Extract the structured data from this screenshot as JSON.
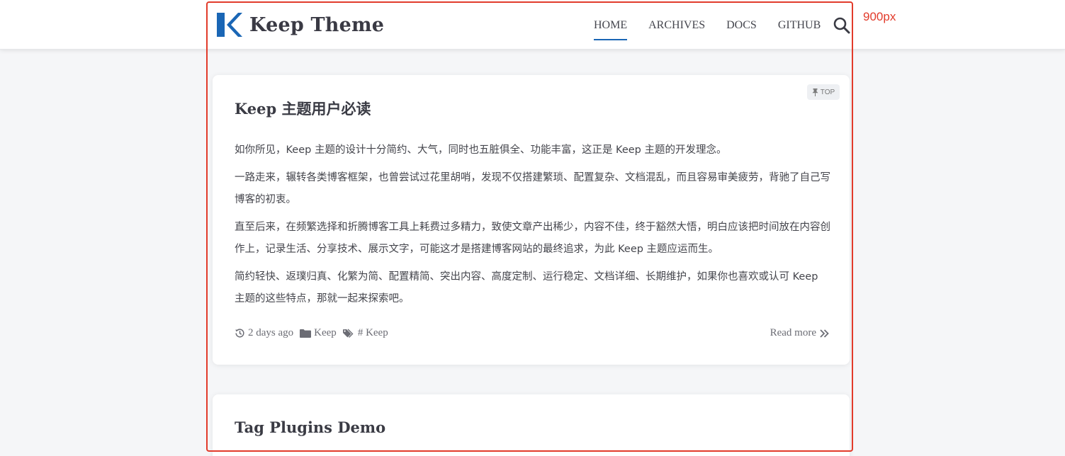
{
  "header": {
    "site_title": "Keep Theme",
    "nav": [
      {
        "label": "HOME",
        "active": true
      },
      {
        "label": "ARCHIVES",
        "active": false
      },
      {
        "label": "DOCS",
        "active": false
      },
      {
        "label": "GITHUB",
        "active": false
      }
    ],
    "search_icon": "search-icon",
    "accent_color": "#1a66b5"
  },
  "annotation": {
    "width_label": "900px",
    "color": "#e23b2b"
  },
  "posts": [
    {
      "badge": "TOP",
      "title": "Keep 主题用户必读",
      "paragraphs": [
        "如你所见，Keep 主题的设计十分简约、大气，同时也五脏俱全、功能丰富，这正是 Keep 主题的开发理念。",
        "一路走来，辗转各类博客框架，也曾尝试过花里胡哨，发现不仅搭建繁琐、配置复杂、文档混乱，而且容易审美疲劳，背驰了自己写博客的初衷。",
        "直至后来，在频繁选择和折腾博客工具上耗费过多精力，致使文章产出稀少，内容不佳，终于豁然大悟，明白应该把时间放在内容创作上，记录生活、分享技术、展示文字，可能这才是搭建博客网站的最终追求，为此 Keep 主题应运而生。",
        "简约轻快、返璞归真、化繁为简、配置精简、突出内容、高度定制、运行稳定、文档详细、长期维护，如果你也喜欢或认可 Keep 主题的这些特点，那就一起来探索吧。"
      ],
      "meta": {
        "date": "2 days ago",
        "category": "Keep",
        "tag": "# Keep"
      },
      "read_more": "Read more"
    },
    {
      "title": "Tag Plugins Demo"
    }
  ]
}
